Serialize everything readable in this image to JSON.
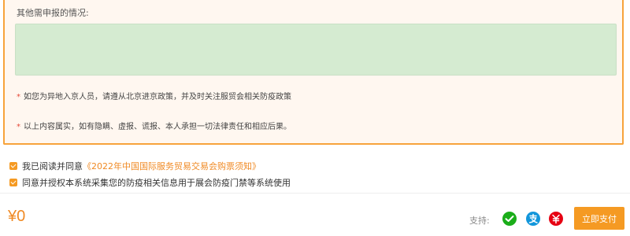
{
  "form": {
    "other_label": "其他需申报的情况:",
    "textarea_value": "",
    "notices": [
      {
        "star": "*",
        "text": "如您为异地入京人员，请遵从北京进京政策，并及时关注服贸会相关防疫政策"
      },
      {
        "star": "*",
        "text": "以上内容属实，如有隐瞒、虚报、谎报、本人承担一切法律责任和相应后果。"
      }
    ]
  },
  "agreements": [
    {
      "checked": true,
      "prefix": "我已阅读并同意",
      "link": "《2022年中国国际服务贸易交易会购票须知》"
    },
    {
      "checked": true,
      "prefix": "同意并授权本系统采集您的防疫相关信息用于展会防疫门禁等系统使用"
    }
  ],
  "footer": {
    "price": "¥0",
    "support_label": "支持:",
    "payment_icons": [
      "wechat-pay-icon",
      "alipay-icon",
      "unionpay-icon"
    ],
    "pay_button": "立即支付"
  },
  "colors": {
    "accent": "#f59a23",
    "card_border": "#f7a33b",
    "card_bg": "#fff7f0",
    "textarea_bg": "#d5ebd1",
    "required_star": "#e64a3a",
    "wechat": "#1aad19",
    "alipay": "#1296db",
    "unionpay": "#e60012"
  }
}
